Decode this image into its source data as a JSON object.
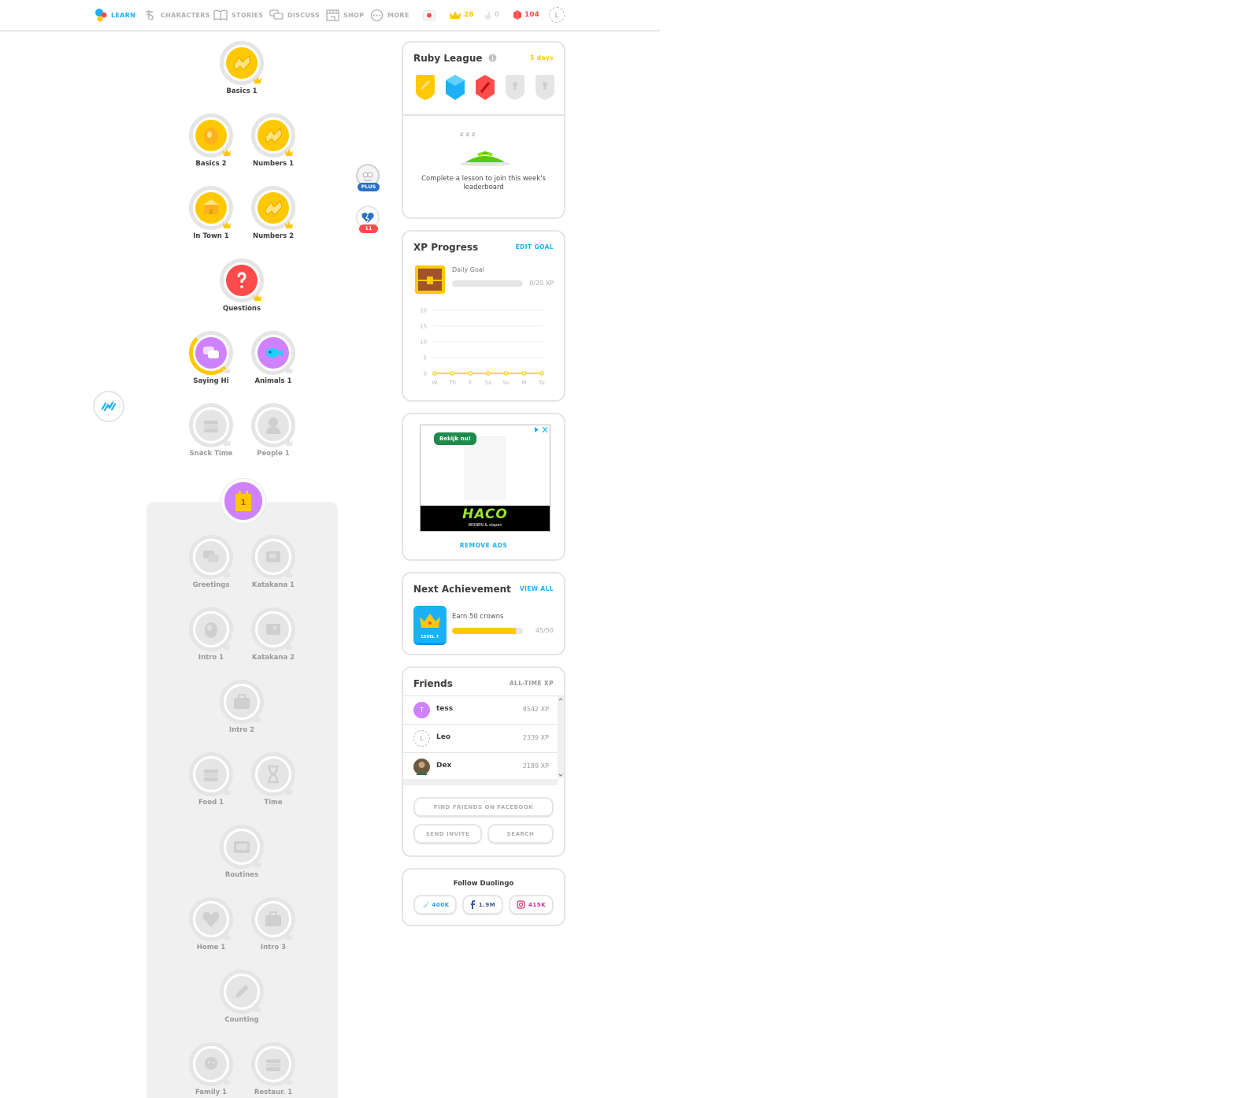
{
  "nav": {
    "items": [
      {
        "label": "LEARN",
        "icon": "duolingo-dots-icon",
        "active": true
      },
      {
        "label": "CHARACTERS",
        "icon": "characters-icon",
        "active": false
      },
      {
        "label": "STORIES",
        "icon": "book-icon",
        "active": false
      },
      {
        "label": "DISCUSS",
        "icon": "speech-bubbles-icon",
        "active": false
      },
      {
        "label": "SHOP",
        "icon": "store-icon",
        "active": false
      },
      {
        "label": "MORE",
        "icon": "more-dots-icon",
        "active": false
      }
    ],
    "language_flag": "japanese-flag-icon",
    "crowns": "28",
    "streak": "0",
    "gems": "104",
    "avatar_initial": "L"
  },
  "skills": {
    "basics1": "Basics 1",
    "basics2": "Basics 2",
    "numbers1": "Numbers 1",
    "intown1": "In Town 1",
    "numbers2": "Numbers 2",
    "questions": "Questions",
    "sayinghi": "Saying Hi",
    "animals1": "Animals 1",
    "snacktime": "Snack Time",
    "people1": "People 1",
    "greetings": "Greetings",
    "katakana1": "Katakana 1",
    "intro1": "Intro 1",
    "katakana2": "Katakana 2",
    "intro2": "Intro 2",
    "food1": "Food 1",
    "time": "Time",
    "routines": "Routines",
    "home1": "Home 1",
    "intro3": "Intro 3",
    "counting": "Counting",
    "family1": "Family 1",
    "restaur1": "Restaur. 1"
  },
  "checkpoint_number": "1",
  "side_badges": {
    "plus_label": "PLUS",
    "hearts_count": "11"
  },
  "league": {
    "title": "Ruby League",
    "days_left": "5 days",
    "message": "Complete a lesson to join this week's leaderboard",
    "sleep_letters": "z z z"
  },
  "xp": {
    "title": "XP Progress",
    "edit_goal": "EDIT GOAL",
    "daily_goal_label": "Daily Goal",
    "progress_text": "0/20 XP",
    "daily_goal_fraction": 0
  },
  "chart_data": {
    "type": "line",
    "categories": [
      "W",
      "Th",
      "F",
      "Sa",
      "Su",
      "M",
      "Tu"
    ],
    "values": [
      0,
      0,
      0,
      0,
      0,
      0,
      0
    ],
    "y_ticks": [
      "0",
      "5",
      "10",
      "15",
      "20"
    ],
    "ylim": [
      0,
      20
    ],
    "goal_line": 20,
    "color": "#ffc800",
    "grid": true
  },
  "ad": {
    "cta": "Bekijk nu!",
    "brand": "HACO",
    "tagline": "WONEN & slapen",
    "remove_ads": "REMOVE ADS"
  },
  "achievement": {
    "title": "Next Achievement",
    "view_all": "VIEW ALL",
    "badge_level": "LEVEL 7",
    "description": "Earn 50 crowns",
    "progress_text": "45/50",
    "progress_fraction": 0.9
  },
  "friends": {
    "title": "Friends",
    "column_label": "ALL-TIME XP",
    "list": [
      {
        "initial": "T",
        "name": "tess",
        "xp": "8542 XP",
        "color": "#ce82ff"
      },
      {
        "initial": "L",
        "name": "Leo",
        "xp": "2339 XP",
        "color": "#ffffff"
      },
      {
        "initial": "",
        "name": "Dex",
        "xp": "2189 XP",
        "color": "#6b5a3e"
      }
    ],
    "find_facebook": "FIND FRIENDS ON FACEBOOK",
    "send_invite": "SEND INVITE",
    "search": "SEARCH"
  },
  "follow": {
    "title": "Follow Duolingo",
    "twitter": "400K",
    "facebook": "1.9M",
    "instagram": "415K"
  },
  "colors": {
    "blue": "#1cb0f6",
    "gold": "#ffc800",
    "red": "#ff4b4b",
    "purple": "#ce82ff",
    "gray": "#e5e5e5"
  }
}
